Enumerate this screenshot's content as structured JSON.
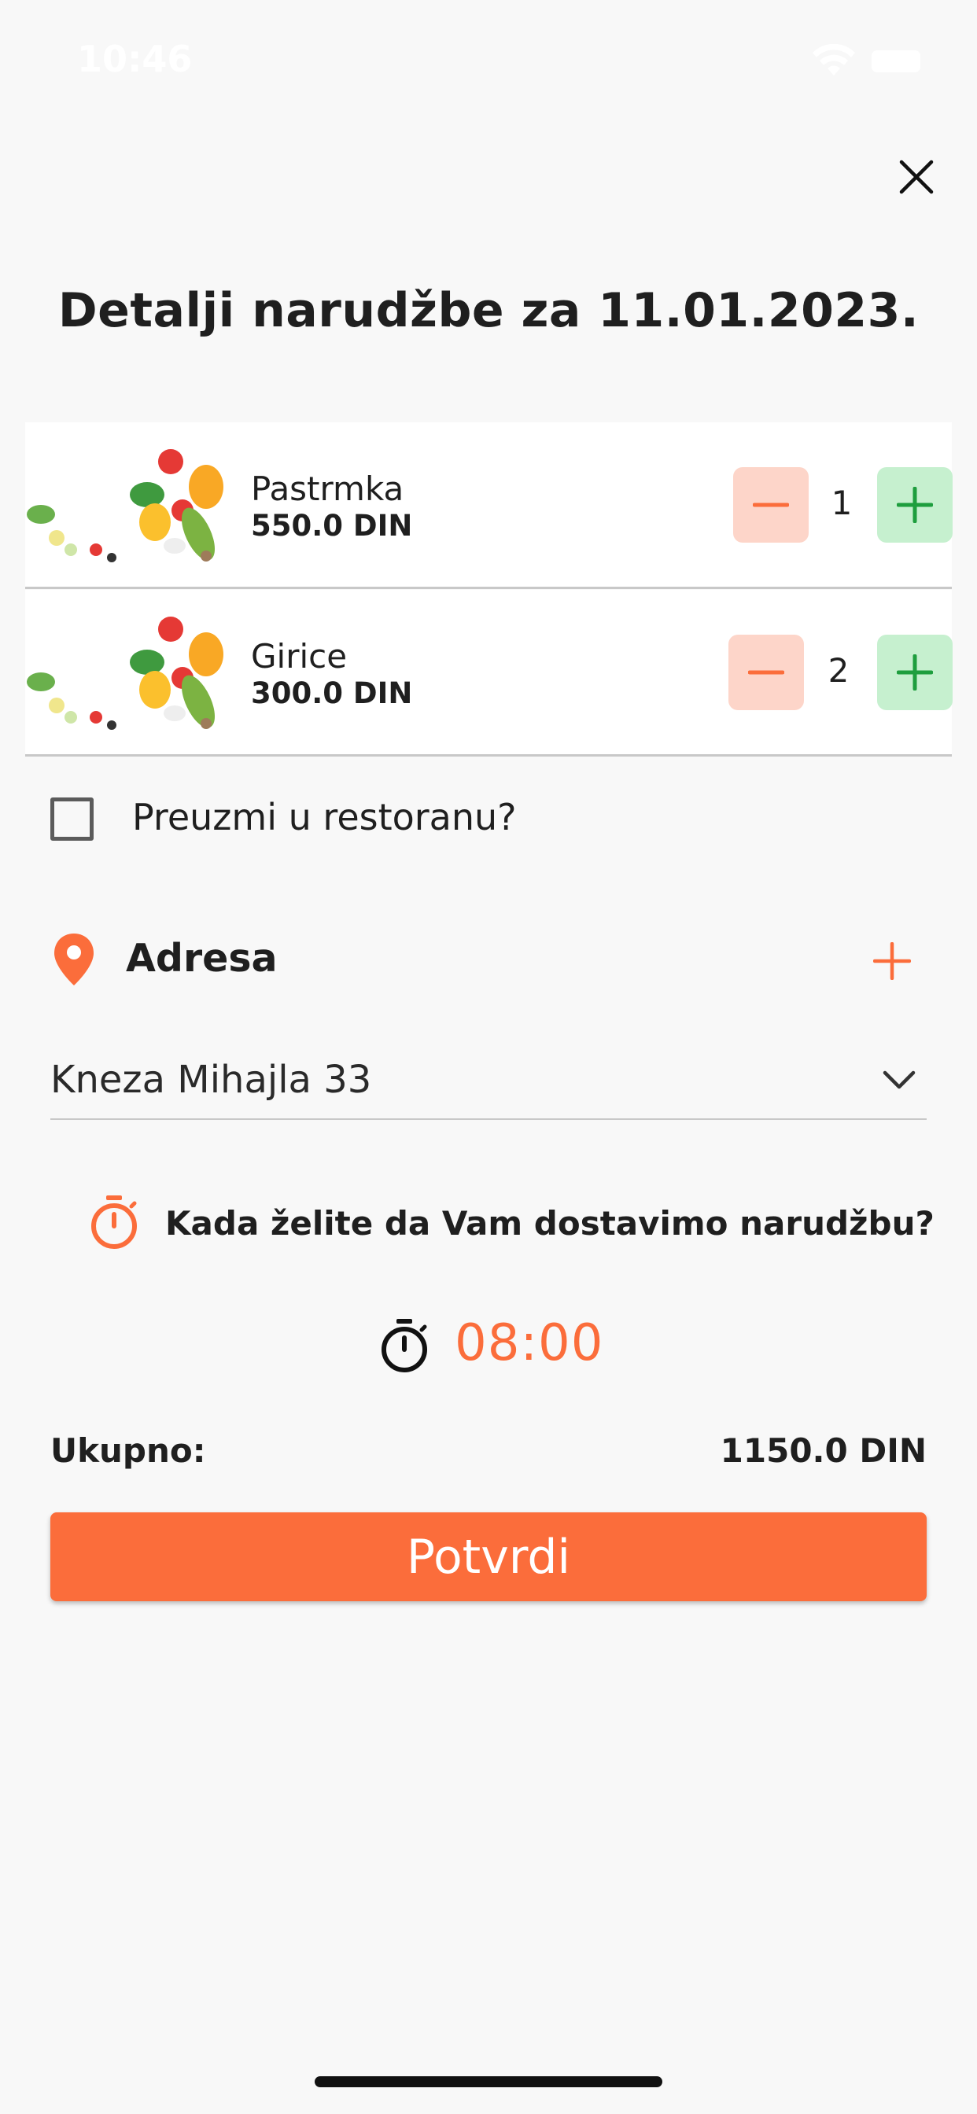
{
  "status_bar": {
    "time": "10:46"
  },
  "title": "Detalji narudžbe za 11.01.2023.",
  "items": [
    {
      "name": "Pastrmka",
      "price": "550.0 DIN",
      "quantity": "1"
    },
    {
      "name": "Girice",
      "price": "300.0 DIN",
      "quantity": "2"
    }
  ],
  "pickup": {
    "label": "Preuzmi u restoranu?",
    "checked": false
  },
  "address": {
    "title": "Adresa",
    "selected": "Kneza Mihajla 33"
  },
  "delivery": {
    "question": "Kada želite da Vam dostavimo narudžbu?",
    "time": "08:00"
  },
  "total": {
    "label": "Ukupno:",
    "value": "1150.0 DIN"
  },
  "confirm_label": "Potvrdi",
  "colors": {
    "accent": "#fb6d3b",
    "minus_bg": "#fdd5c9",
    "plus_bg": "#c6f0cf",
    "plus_fg": "#1e9e3e",
    "background": "#f8f8f8"
  },
  "icons": [
    "wifi-icon",
    "battery-icon",
    "close-icon",
    "minus-icon",
    "plus-icon",
    "location-pin-icon",
    "chevron-down-icon",
    "timer-icon"
  ]
}
